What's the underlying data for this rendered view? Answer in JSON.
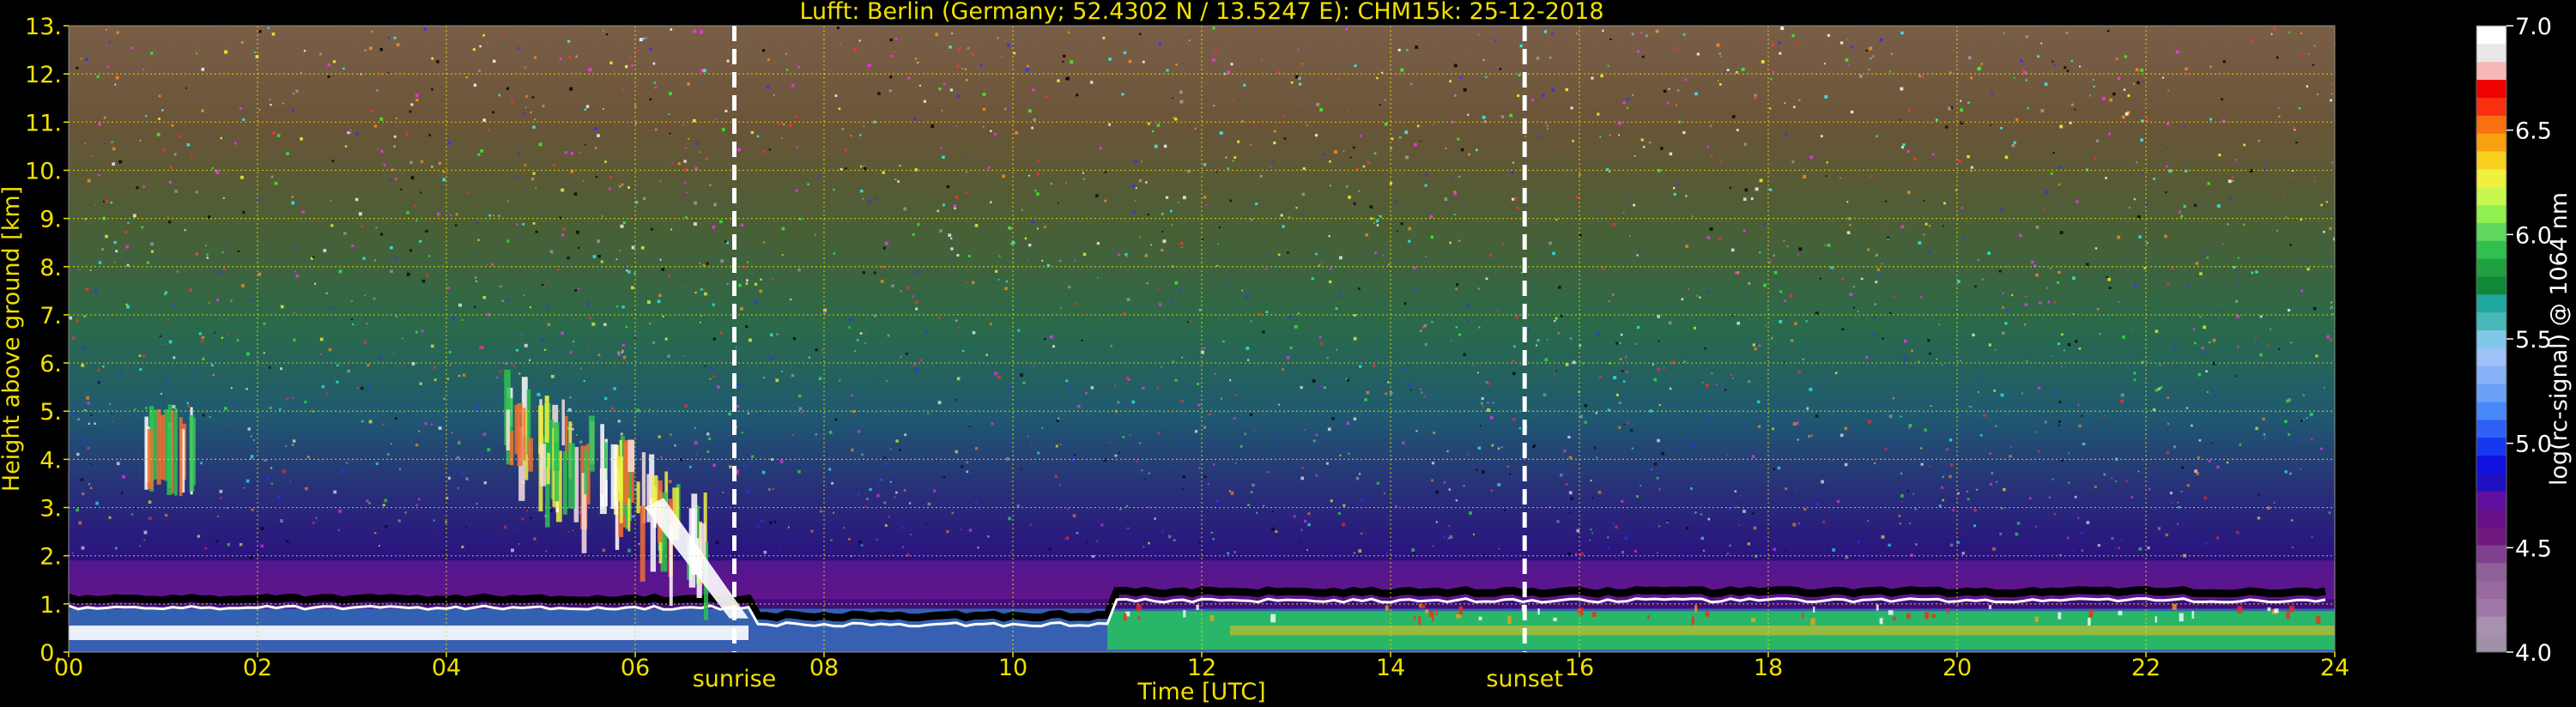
{
  "chart_data": {
    "type": "heatmap",
    "title": "Lufft: Berlin (Germany; 52.4302 N / 13.5247 E):    CHM15k: 25-12-2018",
    "xlabel": "Time [UTC]",
    "ylabel": "Height above ground [km]",
    "x_ticks": [
      "00",
      "02",
      "04",
      "06",
      "08",
      "10",
      "12",
      "14",
      "16",
      "18",
      "20",
      "22",
      "24"
    ],
    "y_ticks": [
      "0.",
      "1.",
      "2.",
      "3.",
      "4.",
      "5.",
      "6.",
      "7.",
      "8.",
      "9.",
      "10.",
      "11.",
      "12.",
      "13."
    ],
    "xlim": [
      0,
      24
    ],
    "ylim": [
      0,
      13
    ],
    "grid": true,
    "markers": [
      {
        "label": "sunrise",
        "time": 7.05
      },
      {
        "label": "sunset",
        "time": 15.42
      }
    ],
    "colorbar": {
      "label": "log(rc-signal) @ 1064 nm",
      "ticks": [
        "4.0",
        "4.5",
        "5.0",
        "5.5",
        "6.0",
        "6.5",
        "7.0"
      ],
      "range": [
        4.0,
        7.0
      ],
      "colors": [
        "#a090a8",
        "#a890b0",
        "#a078a8",
        "#986aa0",
        "#906098",
        "#804090",
        "#701880",
        "#68108a",
        "#6010a0",
        "#2010c0",
        "#1010e0",
        "#1838f0",
        "#3060f8",
        "#4888f8",
        "#6ca0f8",
        "#88b0f8",
        "#a0c0f8",
        "#80c8e8",
        "#48b8b8",
        "#20a8a0",
        "#108838",
        "#20a040",
        "#30c050",
        "#60d860",
        "#90f050",
        "#c8f850",
        "#f0f040",
        "#f8d020",
        "#f8a010",
        "#f87010",
        "#f83010",
        "#f00000",
        "#f8b8b8",
        "#e8e8e8",
        "#ffffff"
      ]
    },
    "layers_km": {
      "black_signal_top": 1.1,
      "aerosol_layer_top": 0.9
    }
  }
}
